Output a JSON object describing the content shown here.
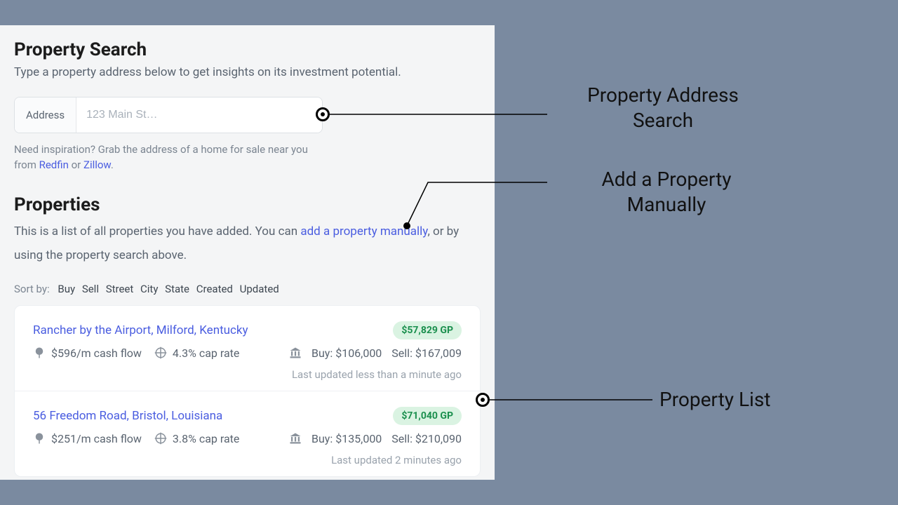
{
  "search": {
    "heading": "Property Search",
    "subtitle": "Type a property address below to get insights on its investment potential.",
    "address_label": "Address",
    "placeholder": "123 Main St…",
    "hint_prefix": "Need inspiration? Grab the address of a home for sale near you from ",
    "hint_link1": "Redfin",
    "hint_mid": " or ",
    "hint_link2": "Zillow",
    "hint_suffix": "."
  },
  "properties": {
    "heading": "Properties",
    "desc_prefix": "This is a list of all properties you have added. You can ",
    "desc_link": "add a property manually",
    "desc_suffix": ", or by using the property search above.",
    "sort_label": "Sort by:",
    "sort_options": [
      "Buy",
      "Sell",
      "Street",
      "City",
      "State",
      "Created",
      "Updated"
    ],
    "items": [
      {
        "title": "Rancher by the Airport, Milford, Kentucky",
        "gp": "$57,829 GP",
        "cashflow": "$596/m cash flow",
        "cap": "4.3% cap rate",
        "buy": "Buy: $106,000",
        "sell": "Sell: $167,009",
        "updated": "Last updated less than a minute ago"
      },
      {
        "title": "56 Freedom Road, Bristol, Louisiana",
        "gp": "$71,040 GP",
        "cashflow": "$251/m cash flow",
        "cap": "3.8% cap rate",
        "buy": "Buy: $135,000",
        "sell": "Sell: $210,090",
        "updated": "Last updated 2 minutes ago"
      }
    ]
  },
  "callouts": {
    "c1a": "Property Address",
    "c1b": "Search",
    "c2a": "Add a Property",
    "c2b": "Manually",
    "c3": "Property List"
  }
}
